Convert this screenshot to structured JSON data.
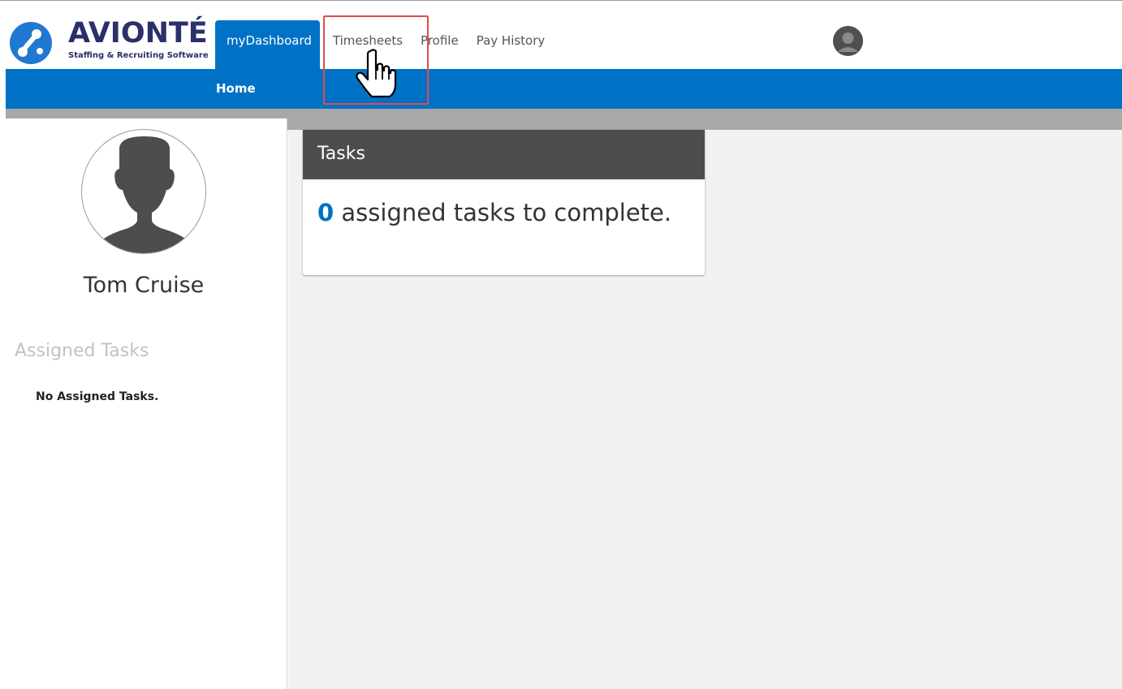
{
  "brand": {
    "name": "AVIONTÉ",
    "tagline": "Staffing & Recruiting Software",
    "color": "#1f79d1",
    "text_color": "#29306b"
  },
  "nav": {
    "tabs": [
      {
        "label": "myDashboard",
        "active": true
      },
      {
        "label": "Timesheets",
        "active": false
      },
      {
        "label": "Profile",
        "active": false
      },
      {
        "label": "Pay History",
        "active": false
      }
    ]
  },
  "subnav": {
    "home_label": "Home",
    "color": "#0072c6"
  },
  "profile": {
    "name": "Tom Cruise"
  },
  "assigned_tasks": {
    "heading": "Assigned Tasks",
    "empty_text": "No Assigned Tasks."
  },
  "tasks_card": {
    "title": "Tasks",
    "count": "0",
    "suffix": "assigned tasks to complete."
  },
  "overlay": {
    "highlighted_item": "Timesheets",
    "highlight_color": "#e24b4b",
    "cursor_icon": "hand-pointer-icon"
  }
}
